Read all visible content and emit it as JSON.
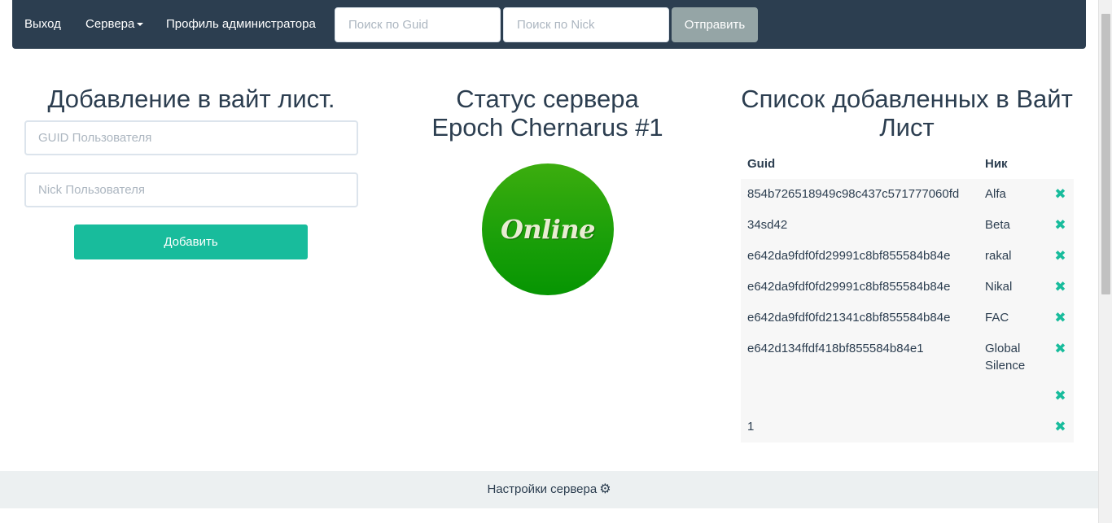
{
  "navbar": {
    "logout_label": "Выход",
    "servers_label": "Сервера",
    "admin_profile_label": "Профиль администратора",
    "search_guid_placeholder": "Поиск по Guid",
    "search_nick_placeholder": "Поиск по Nick",
    "submit_label": "Отправить"
  },
  "add_whitelist": {
    "title": "Добавление в вайт лист.",
    "guid_placeholder": "GUID Пользователя",
    "nick_placeholder": "Nick Пользователя",
    "add_label": "Добавить"
  },
  "server_status": {
    "title_line1": "Статус сервера",
    "title_line2": "Epoch Chernarus #1",
    "status": "Online"
  },
  "whitelist": {
    "title_line1": "Список добавленных в Вайт",
    "title_line2": "Лист",
    "headers": {
      "guid": "Guid",
      "nick": "Ник"
    },
    "rows": [
      {
        "guid": "854b726518949c98c437c571777060fd",
        "nick": "Alfa"
      },
      {
        "guid": "34sd42",
        "nick": "Beta"
      },
      {
        "guid": "e642da9fdf0fd29991c8bf855584b84e",
        "nick": "rakal"
      },
      {
        "guid": "e642da9fdf0fd29991c8bf855584b84e",
        "nick": "Nikal"
      },
      {
        "guid": "e642da9fdf0fd21341c8bf855584b84e",
        "nick": "FAC"
      },
      {
        "guid": "e642d134ffdf418bf855584b84e1",
        "nick": "Global Silence"
      },
      {
        "guid": "",
        "nick": ""
      },
      {
        "guid": "1",
        "nick": ""
      }
    ],
    "delete_glyph": "✖"
  },
  "footer": {
    "settings_label": "Настройки сервера"
  },
  "colors": {
    "navbar": "#2c3e50",
    "accent": "#18bc9c",
    "submit": "#95a5a6",
    "online": "#1ea10a"
  }
}
